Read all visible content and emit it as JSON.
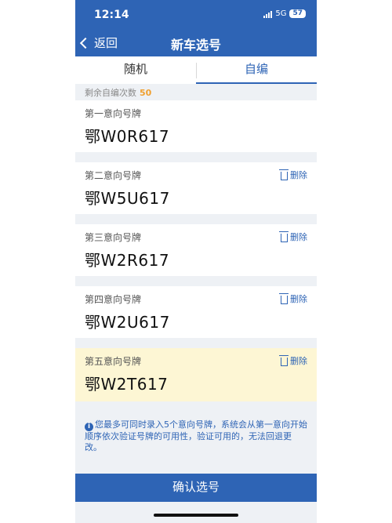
{
  "status": {
    "time": "12:14",
    "network": "5G",
    "battery": "57"
  },
  "nav": {
    "back_label": "返回",
    "title": "新车选号"
  },
  "tabs": [
    {
      "label": "随机",
      "active": false
    },
    {
      "label": "自编",
      "active": true
    }
  ],
  "remaining": {
    "label": "剩余自编次数",
    "count": "50"
  },
  "plates": [
    {
      "label": "第一意向号牌",
      "plate": "鄂W0R617",
      "delete_label": ""
    },
    {
      "label": "第二意向号牌",
      "plate": "鄂W5U617",
      "delete_label": "删除"
    },
    {
      "label": "第三意向号牌",
      "plate": "鄂W2R617",
      "delete_label": "删除"
    },
    {
      "label": "第四意向号牌",
      "plate": "鄂W2U617",
      "delete_label": "删除"
    },
    {
      "label": "第五意向号牌",
      "plate": "鄂W2T617",
      "delete_label": "删除"
    }
  ],
  "notice": "您最多可同时录入5个意向号牌，系统会从第一意向开始顺序依次验证号牌的可用性，验证可用的，无法回退更改。",
  "confirm_label": "确认选号",
  "colors": {
    "primary": "#2e64b5",
    "highlight": "#fdf6d4",
    "count": "#f0a030"
  }
}
